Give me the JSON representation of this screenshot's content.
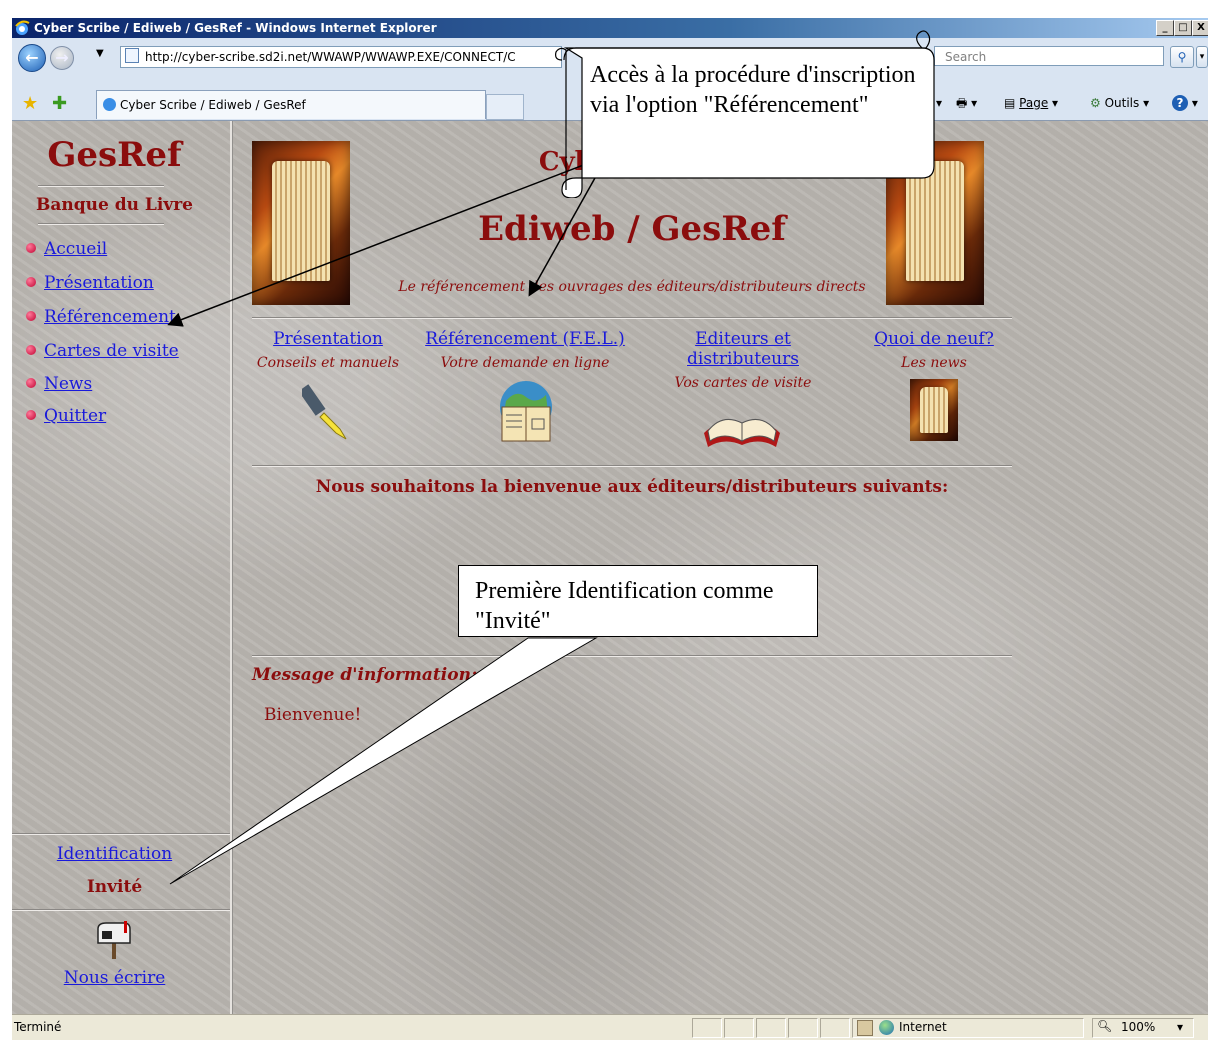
{
  "window": {
    "title": "Cyber Scribe / Ediweb / GesRef - Windows Internet Explorer",
    "min": "_",
    "max": "□",
    "close": "X"
  },
  "nav": {
    "address": "http://cyber-scribe.sd2i.net/WWAWP/WWAWP.EXE/CONNECT/C",
    "search_placeholder": "Search"
  },
  "tab": {
    "title": "Cyber Scribe / Ediweb / GesRef"
  },
  "commands": {
    "page": "Page",
    "tools": "Outils"
  },
  "sidebar": {
    "title": "GesRef",
    "subtitle": "Banque du Livre",
    "items": [
      {
        "label": "Accueil"
      },
      {
        "label": "Présentation"
      },
      {
        "label": "Référencement"
      },
      {
        "label": "Cartes de visite"
      },
      {
        "label": "News"
      },
      {
        "label": "Quitter"
      }
    ],
    "identification": "Identification",
    "user": "Invité",
    "contact": "Nous écrire"
  },
  "main": {
    "title_line1": "Cyber Scribe",
    "title_line2": "Ediweb / GesRef",
    "tagline": "Le référencement des ouvrages des éditeurs/distributeurs directs",
    "menu": [
      {
        "label": "Présentation",
        "sub": "Conseils et manuels",
        "icon": "pen-icon"
      },
      {
        "label": "Référencement (F.E.L.)",
        "sub": "Votre demande en ligne",
        "icon": "globe-book-icon"
      },
      {
        "label": "Editeurs et distributeurs",
        "sub": "Vos cartes de visite",
        "icon": "open-book-icon"
      },
      {
        "label": "Quoi de neuf?",
        "sub": "Les news",
        "icon": "book-icon"
      }
    ],
    "welcome": "Nous souhaitons la bienvenue aux éditeurs/distributeurs suivants:",
    "message_title": "Message d'information:",
    "message_body": "Bienvenue!"
  },
  "callouts": {
    "registration": "Accès à la procédure d'inscription via l'option \"Référencement\"",
    "guest": "Première Identification comme \"Invité\""
  },
  "status": {
    "text": "Terminé",
    "zone": "Internet",
    "zoom": "100%"
  },
  "colors": {
    "accent": "#8b0d0d",
    "link": "#1a1adb",
    "background": "#b9b5b0"
  }
}
